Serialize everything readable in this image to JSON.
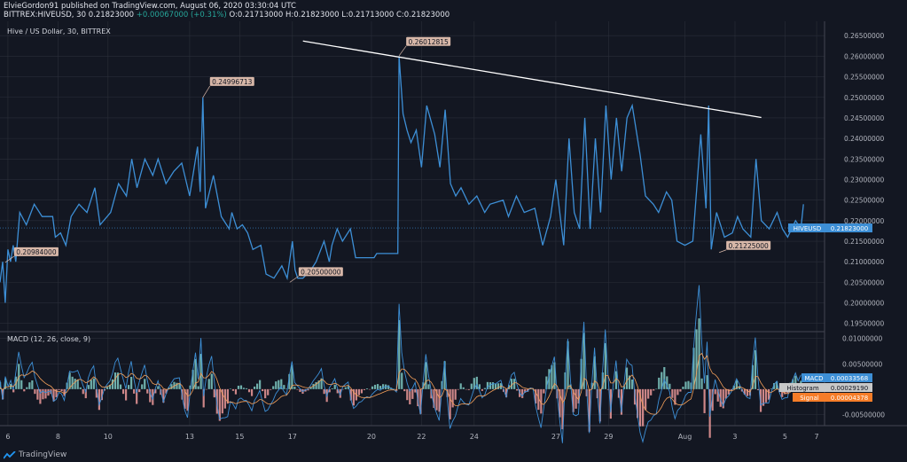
{
  "header": {
    "publish_line": "ElvieGordon91 published on TradingView.com, August 06, 2020 03:30:04 UTC",
    "symbol_line": "BITTREX:HIVEUSD, 30",
    "open_close": "0.21823000",
    "change": "+0.00067000 (+0.31%)",
    "o": "O:0.21713000",
    "h": "H:0.21823000",
    "l": "L:0.21713000",
    "c": "C:0.21823000"
  },
  "main_title": "Hive / US Dollar, 30, BITTREX",
  "macd_title": "MACD (12, 26, close, 9)",
  "footer_brand": "TradingView",
  "colors": {
    "background": "#131722",
    "grid": "#2a2e39",
    "price_line": "#3d8fd6",
    "trendline": "#ffffff",
    "price_tag": "#3d8fd6",
    "macd_tag": "#3d8fd6",
    "histogram_tag": "#c8c8c8",
    "signal_tag": "#f57c28",
    "callout_bg": "#d7b7a8",
    "hist_pos": "#80cbc4",
    "hist_neg": "#ef9a9a"
  },
  "chart_data": [
    {
      "type": "line",
      "title": "Hive / US Dollar, 30, BITTREX",
      "x_ticks": [
        "6",
        "8",
        "10",
        "13",
        "15",
        "17",
        "20",
        "22",
        "24",
        "27",
        "29",
        "Aug",
        "3",
        "5",
        "7"
      ],
      "y_ticks": [
        "0.26500000",
        "0.26000000",
        "0.25500000",
        "0.25000000",
        "0.24500000",
        "0.24000000",
        "0.23500000",
        "0.23000000",
        "0.22500000",
        "0.22000000",
        "0.21500000",
        "0.21000000",
        "0.20500000",
        "0.20000000",
        "0.19500000"
      ],
      "ylim": [
        0.193,
        0.2685
      ],
      "x_start": "Jul 6",
      "x_end": "Aug 7",
      "series": [
        {
          "name": "HIVEUSD",
          "points": [
            [
              6.0,
              0.205
            ],
            [
              6.1,
              0.21
            ],
            [
              6.2,
              0.2
            ],
            [
              6.3,
              0.213
            ],
            [
              6.4,
              0.21
            ],
            [
              6.5,
              0.214
            ],
            [
              6.6,
              0.21
            ],
            [
              6.75,
              0.222
            ],
            [
              7.0,
              0.219
            ],
            [
              7.3,
              0.224
            ],
            [
              7.6,
              0.221
            ],
            [
              8.0,
              0.221
            ],
            [
              8.1,
              0.216
            ],
            [
              8.3,
              0.217
            ],
            [
              8.5,
              0.214
            ],
            [
              8.7,
              0.221
            ],
            [
              9.0,
              0.224
            ],
            [
              9.3,
              0.222
            ],
            [
              9.6,
              0.228
            ],
            [
              9.8,
              0.219
            ],
            [
              10.2,
              0.222
            ],
            [
              10.5,
              0.229
            ],
            [
              10.8,
              0.226
            ],
            [
              11.0,
              0.235
            ],
            [
              11.2,
              0.228
            ],
            [
              11.5,
              0.235
            ],
            [
              11.8,
              0.231
            ],
            [
              12.0,
              0.235
            ],
            [
              12.3,
              0.229
            ],
            [
              12.6,
              0.232
            ],
            [
              12.9,
              0.234
            ],
            [
              13.2,
              0.226
            ],
            [
              13.5,
              0.238
            ],
            [
              13.6,
              0.227
            ],
            [
              13.7,
              0.25
            ],
            [
              13.8,
              0.223
            ],
            [
              14.1,
              0.231
            ],
            [
              14.4,
              0.221
            ],
            [
              14.7,
              0.218
            ],
            [
              14.8,
              0.222
            ],
            [
              15.0,
              0.218
            ],
            [
              15.2,
              0.219
            ],
            [
              15.4,
              0.217
            ],
            [
              15.6,
              0.213
            ],
            [
              15.9,
              0.214
            ],
            [
              16.1,
              0.207
            ],
            [
              16.4,
              0.206
            ],
            [
              16.7,
              0.209
            ],
            [
              16.9,
              0.206
            ],
            [
              17.1,
              0.215
            ],
            [
              17.2,
              0.208
            ],
            [
              17.3,
              0.206
            ],
            [
              17.5,
              0.206
            ],
            [
              17.8,
              0.208
            ],
            [
              18.0,
              0.21
            ],
            [
              18.3,
              0.215
            ],
            [
              18.5,
              0.21
            ],
            [
              18.6,
              0.214
            ],
            [
              18.8,
              0.218
            ],
            [
              19.0,
              0.215
            ],
            [
              19.3,
              0.218
            ],
            [
              19.5,
              0.211
            ],
            [
              19.8,
              0.211
            ],
            [
              20.0,
              0.211
            ],
            [
              20.2,
              0.211
            ],
            [
              20.3,
              0.212
            ],
            [
              20.7,
              0.212
            ],
            [
              21.1,
              0.212
            ],
            [
              21.15,
              0.26
            ],
            [
              21.3,
              0.246
            ],
            [
              21.45,
              0.242
            ],
            [
              21.6,
              0.239
            ],
            [
              21.8,
              0.242
            ],
            [
              22.0,
              0.233
            ],
            [
              22.2,
              0.248
            ],
            [
              22.5,
              0.241
            ],
            [
              22.7,
              0.233
            ],
            [
              22.9,
              0.247
            ],
            [
              23.1,
              0.229
            ],
            [
              23.3,
              0.226
            ],
            [
              23.5,
              0.228
            ],
            [
              23.8,
              0.224
            ],
            [
              24.1,
              0.226
            ],
            [
              24.4,
              0.222
            ],
            [
              24.6,
              0.224
            ],
            [
              25.1,
              0.225
            ],
            [
              25.3,
              0.221
            ],
            [
              25.6,
              0.226
            ],
            [
              25.9,
              0.222
            ],
            [
              26.3,
              0.223
            ],
            [
              26.6,
              0.214
            ],
            [
              26.9,
              0.221
            ],
            [
              27.1,
              0.23
            ],
            [
              27.4,
              0.214
            ],
            [
              27.6,
              0.24
            ],
            [
              27.8,
              0.222
            ],
            [
              28.0,
              0.218
            ],
            [
              28.2,
              0.245
            ],
            [
              28.4,
              0.218
            ],
            [
              28.6,
              0.24
            ],
            [
              28.8,
              0.222
            ],
            [
              29.0,
              0.248
            ],
            [
              29.2,
              0.23
            ],
            [
              29.4,
              0.245
            ],
            [
              29.6,
              0.232
            ],
            [
              29.8,
              0.245
            ],
            [
              30.0,
              0.248
            ],
            [
              30.3,
              0.236
            ],
            [
              30.5,
              0.226
            ],
            [
              30.8,
              0.224
            ],
            [
              31.0,
              0.222
            ],
            [
              31.3,
              0.227
            ],
            [
              31.5,
              0.225
            ],
            [
              31.7,
              0.215
            ],
            [
              32.0,
              0.214
            ],
            [
              32.3,
              0.215
            ],
            [
              32.6,
              0.241
            ],
            [
              32.8,
              0.223
            ],
            [
              32.9,
              0.248
            ],
            [
              33.0,
              0.213
            ],
            [
              33.2,
              0.222
            ],
            [
              33.5,
              0.216
            ],
            [
              33.8,
              0.217
            ],
            [
              34.0,
              0.221
            ],
            [
              34.2,
              0.218
            ],
            [
              34.5,
              0.216
            ],
            [
              34.7,
              0.235
            ],
            [
              34.9,
              0.22
            ],
            [
              35.2,
              0.218
            ],
            [
              35.5,
              0.222
            ],
            [
              35.7,
              0.218
            ],
            [
              35.9,
              0.216
            ],
            [
              36.2,
              0.22
            ],
            [
              36.4,
              0.218
            ],
            [
              36.5,
              0.224
            ]
          ]
        }
      ],
      "callouts": [
        {
          "label": "0.20984000",
          "x": 6.2,
          "y": 0.20984
        },
        {
          "label": "0.24996713",
          "x": 13.7,
          "y": 0.24996713
        },
        {
          "label": "0.20500000",
          "x": 17.0,
          "y": 0.205
        },
        {
          "label": "0.26012815",
          "x": 21.15,
          "y": 0.26012815
        },
        {
          "label": "0.21225000",
          "x": 33.3,
          "y": 0.21225
        }
      ],
      "trendline": {
        "x0": 17.5,
        "y0": 0.2637,
        "x1": 34.9,
        "y1": 0.2451
      },
      "last_price": {
        "label": "HIVEUSD",
        "value": "0.21823000",
        "y": 0.21823
      }
    },
    {
      "type": "line",
      "title": "MACD (12, 26, close, 9)",
      "y_ticks": [
        "0.01000000",
        "0.00500000",
        "-0.00500000"
      ],
      "ylim": [
        -0.0072,
        0.011
      ],
      "series": [
        {
          "name": "MACD",
          "value": "0.00033568"
        },
        {
          "name": "Histogram",
          "value": "0.00029190"
        },
        {
          "name": "Signal",
          "value": "0.00004378"
        }
      ]
    }
  ]
}
